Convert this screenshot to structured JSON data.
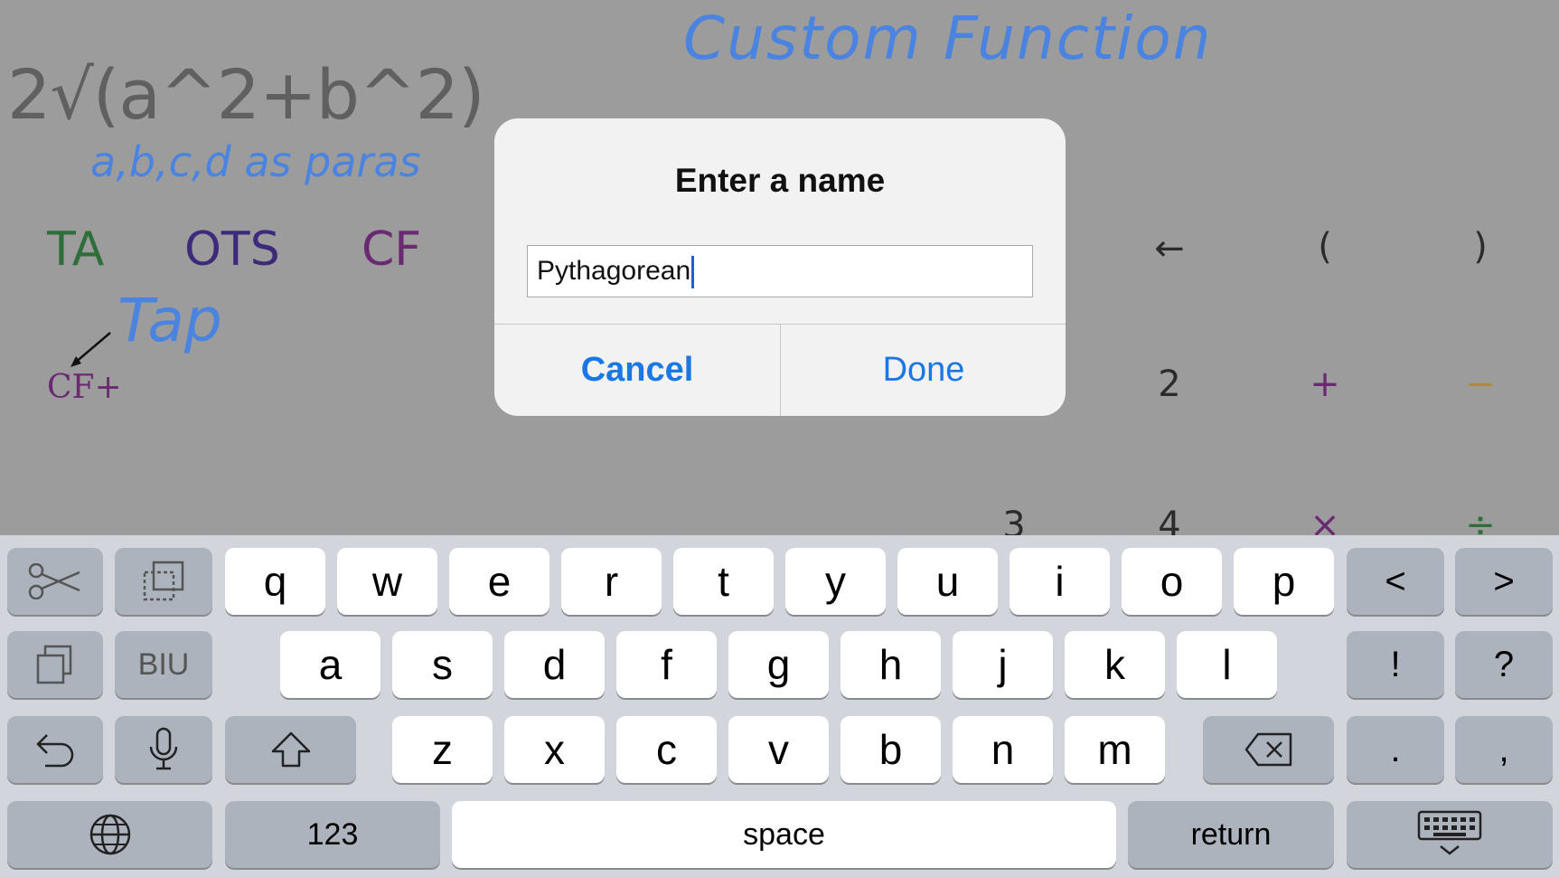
{
  "app": {
    "formula": "2√(a^2+b^2)",
    "params_note": "a,b,c,d as paras",
    "title": "Custom Function",
    "modes": [
      "TA",
      "OTS",
      "CF"
    ],
    "tap_note": "Tap",
    "cf_plus": "CF+",
    "keys": {
      "back": "←",
      "paren_open": "(",
      "paren_close": ")",
      "two": "2",
      "plus": "+",
      "minus": "−",
      "three": "3",
      "four": "4",
      "times": "×",
      "divide": "÷"
    }
  },
  "dialog": {
    "title": "Enter a name",
    "input_value": "Pythagorean",
    "cancel_label": "Cancel",
    "done_label": "Done"
  },
  "keyboard": {
    "row1": [
      "q",
      "w",
      "e",
      "r",
      "t",
      "y",
      "u",
      "i",
      "o",
      "p"
    ],
    "row2": [
      "a",
      "s",
      "d",
      "f",
      "g",
      "h",
      "j",
      "k",
      "l"
    ],
    "row3": [
      "z",
      "x",
      "c",
      "v",
      "b",
      "n",
      "m"
    ],
    "arrows": [
      "<",
      ">"
    ],
    "punct_row2": [
      "!",
      "?"
    ],
    "punct_row3": [
      ".",
      ","
    ],
    "format_label": "BIU",
    "numbers_label": "123",
    "space_label": "space",
    "return_label": "return"
  }
}
